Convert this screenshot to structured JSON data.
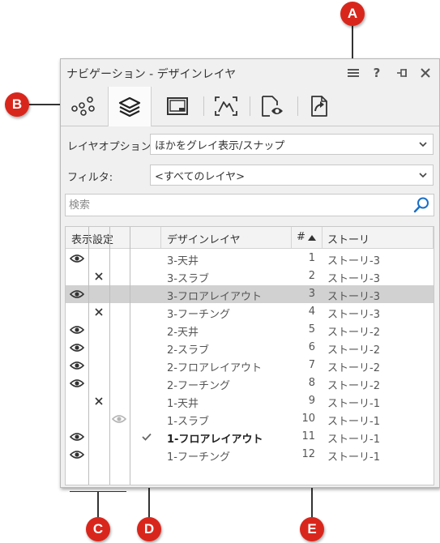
{
  "title": "ナビゲーション - デザインレイヤ",
  "title_buttons": [
    {
      "name": "menu-icon",
      "glyph": "≡"
    },
    {
      "name": "help-icon",
      "glyph": "?"
    },
    {
      "name": "pin-icon",
      "glyph": "⊣"
    },
    {
      "name": "close-icon",
      "glyph": "✕"
    }
  ],
  "callouts": {
    "a": "A",
    "b": "B",
    "c": "C",
    "d": "D",
    "e": "E"
  },
  "layer_options": {
    "label": "レイヤオプション:",
    "value": "ほかをグレイ表示/スナップ"
  },
  "filter": {
    "label": "フィルタ:",
    "value": "<すべてのレイヤ>"
  },
  "search": {
    "placeholder": "検索"
  },
  "columns": {
    "visibility": "表示設定",
    "layer": "デザインレイヤ",
    "number": "#",
    "story": "ストーリ"
  },
  "rows": [
    {
      "vis": "visible",
      "active": false,
      "name": "3-天井",
      "num": "1",
      "story": "ストーリ-3",
      "selected": false
    },
    {
      "vis": "hidden",
      "active": false,
      "name": "3-スラブ",
      "num": "2",
      "story": "ストーリ-3",
      "selected": false
    },
    {
      "vis": "visible",
      "active": false,
      "name": "3-フロアレイアウト",
      "num": "3",
      "story": "ストーリ-3",
      "selected": true
    },
    {
      "vis": "hidden",
      "active": false,
      "name": "3-フーチング",
      "num": "4",
      "story": "ストーリ-3",
      "selected": false
    },
    {
      "vis": "visible",
      "active": false,
      "name": "2-天井",
      "num": "5",
      "story": "ストーリ-2",
      "selected": false
    },
    {
      "vis": "visible",
      "active": false,
      "name": "2-スラブ",
      "num": "6",
      "story": "ストーリ-2",
      "selected": false
    },
    {
      "vis": "visible",
      "active": false,
      "name": "2-フロアレイアウト",
      "num": "7",
      "story": "ストーリ-2",
      "selected": false
    },
    {
      "vis": "visible",
      "active": false,
      "name": "2-フーチング",
      "num": "8",
      "story": "ストーリ-2",
      "selected": false
    },
    {
      "vis": "hidden",
      "active": false,
      "name": "1-天井",
      "num": "9",
      "story": "ストーリ-1",
      "selected": false
    },
    {
      "vis": "grayed",
      "active": false,
      "name": "1-スラブ",
      "num": "10",
      "story": "ストーリ-1",
      "selected": false
    },
    {
      "vis": "visible",
      "active": true,
      "name": "1-フロアレイアウト",
      "num": "11",
      "story": "ストーリ-1",
      "selected": false
    },
    {
      "vis": "visible",
      "active": false,
      "name": "1-フーチング",
      "num": "12",
      "story": "ストーリ-1",
      "selected": false
    }
  ],
  "colors": {
    "callout": "#d9261c",
    "selected_row": "#d1d1d1",
    "search_icon": "#1a6fc9"
  }
}
